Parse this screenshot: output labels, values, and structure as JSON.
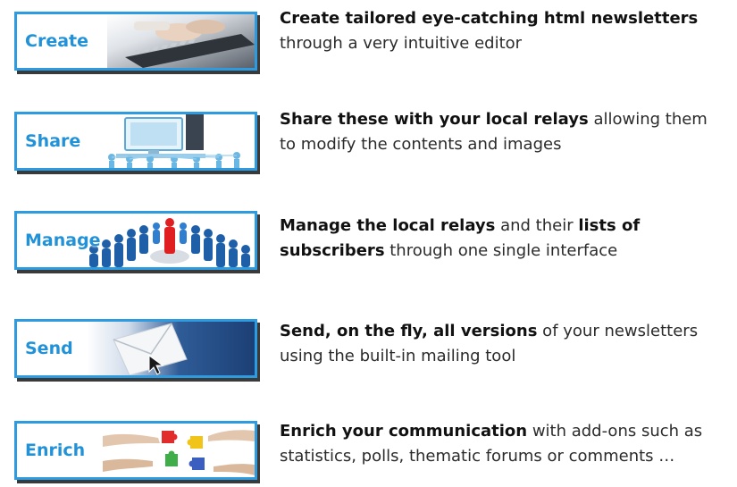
{
  "features": [
    {
      "label": "Create",
      "lines": [
        [
          {
            "t": "Create tailored eye-catching html newsletters",
            "b": true
          }
        ],
        [
          {
            "t": "through a very intuitive editor",
            "b": false
          }
        ]
      ]
    },
    {
      "label": "Share",
      "lines": [
        [
          {
            "t": "Share these with your local relays",
            "b": true
          },
          {
            "t": " allowing them",
            "b": false
          }
        ],
        [
          {
            "t": "to  modify the contents and images",
            "b": false
          }
        ]
      ]
    },
    {
      "label": "Manage",
      "lines": [
        [
          {
            "t": "Manage the local relays",
            "b": true
          },
          {
            "t": " and their ",
            "b": false
          },
          {
            "t": "lists of",
            "b": true
          }
        ],
        [
          {
            "t": "subscribers",
            "b": true
          },
          {
            "t": " through one single interface",
            "b": false
          }
        ]
      ]
    },
    {
      "label": "Send",
      "lines": [
        [
          {
            "t": "Send, on the fly, all versions",
            "b": true
          },
          {
            "t": " of your newsletters",
            "b": false
          }
        ],
        [
          {
            "t": "using the built-in mailing tool",
            "b": false
          }
        ]
      ]
    },
    {
      "label": "Enrich",
      "lines": [
        [
          {
            "t": "Enrich your communication",
            "b": true
          },
          {
            "t": " with add-ons such as",
            "b": false
          }
        ],
        [
          {
            "t": "statistics, polls, thematic forums or comments …",
            "b": false
          }
        ]
      ]
    }
  ],
  "colors": {
    "accent": "#2d9be0",
    "label": "#2292d8",
    "text": "#2b2b2b"
  },
  "icons": [
    "keyboard-icon",
    "network-computer-icon",
    "crowd-icon",
    "envelope-cursor-icon",
    "puzzle-hands-icon"
  ]
}
